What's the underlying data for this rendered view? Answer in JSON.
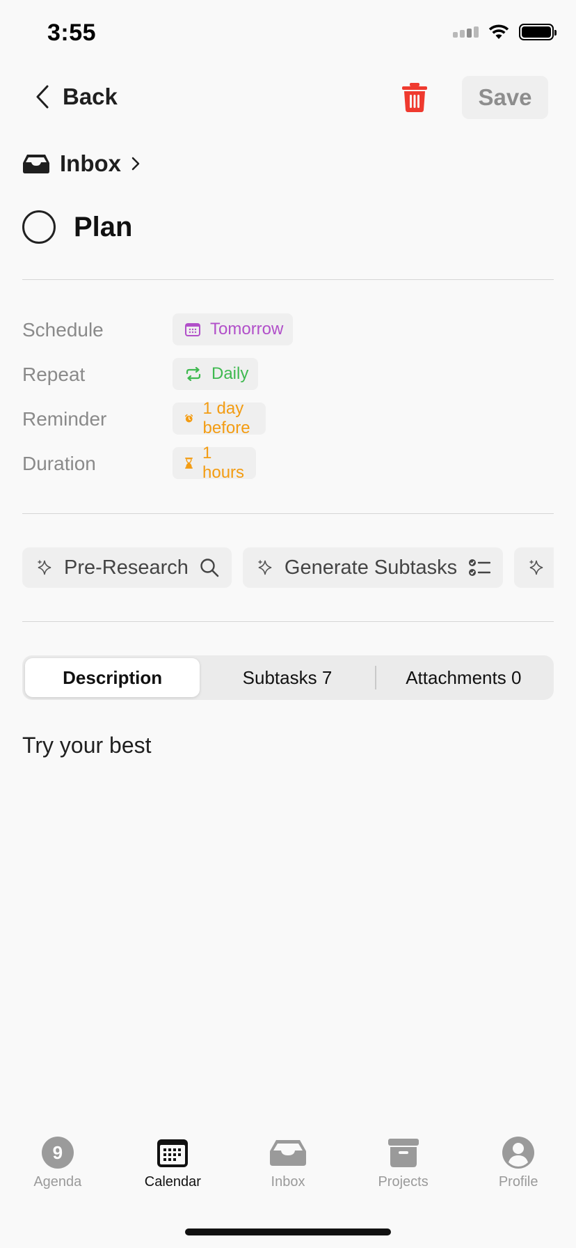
{
  "status_bar": {
    "time": "3:55"
  },
  "header": {
    "back_label": "Back",
    "save_label": "Save"
  },
  "breadcrumb": {
    "label": "Inbox"
  },
  "task": {
    "title": "Plan",
    "completed": false
  },
  "properties": [
    {
      "label": "Schedule",
      "value": "Tomorrow",
      "icon": "calendar-icon",
      "color": "#b14fc9"
    },
    {
      "label": "Repeat",
      "value": "Daily",
      "icon": "repeat-icon",
      "color": "#3fb950"
    },
    {
      "label": "Reminder",
      "value": "1 day before",
      "icon": "alarm-clock-icon",
      "color": "#f39c12"
    },
    {
      "label": "Duration",
      "value": "1 hours",
      "icon": "hourglass-icon",
      "color": "#f39c12"
    }
  ],
  "ai_actions": [
    {
      "label": "Pre-Research",
      "icon": "search-icon"
    },
    {
      "label": "Generate Subtasks",
      "icon": "checklist-icon"
    },
    {
      "label": "",
      "icon": "sparkle-icon"
    }
  ],
  "tabs_segment": {
    "description": "Description",
    "subtasks": "Subtasks 7",
    "attachments": "Attachments 0",
    "active": "description"
  },
  "description_text": "Try your best",
  "tab_bar": {
    "agenda": {
      "label": "Agenda",
      "badge": "9"
    },
    "calendar": {
      "label": "Calendar"
    },
    "inbox": {
      "label": "Inbox"
    },
    "projects": {
      "label": "Projects"
    },
    "profile": {
      "label": "Profile"
    },
    "active": "calendar"
  },
  "colors": {
    "danger": "#ef3a2f",
    "muted": "#9a9a9a"
  }
}
